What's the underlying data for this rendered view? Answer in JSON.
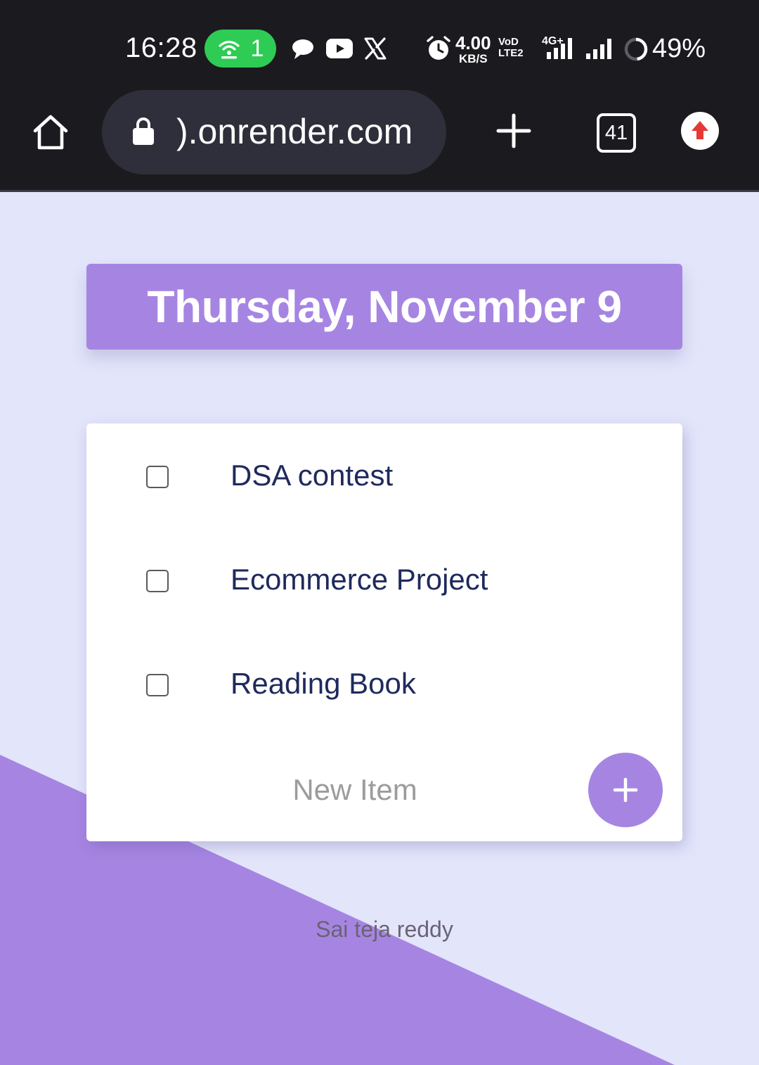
{
  "status_bar": {
    "time": "16:28",
    "hotspot_count": "1",
    "net_speed_value": "4.00",
    "net_speed_unit": "KB/S",
    "volte_line1": "VoD",
    "volte_line2": "LTE2",
    "network_type": "4G+",
    "battery": "49%",
    "notification_icons": [
      "chat-bubble-icon",
      "youtube-icon",
      "x-icon"
    ],
    "system_icons": [
      "alarm-icon",
      "signal-icon",
      "battery-icon"
    ]
  },
  "toolbar": {
    "url": ").onrender.com",
    "tabs_count": "41",
    "icons": [
      "home-icon",
      "lock-icon",
      "new-tab-icon",
      "tabs-icon",
      "update-icon"
    ]
  },
  "page": {
    "title": "Thursday, November 9",
    "items": [
      {
        "label": "DSA contest",
        "checked": false
      },
      {
        "label": "Ecommerce Project",
        "checked": false
      },
      {
        "label": "Reading Book",
        "checked": false
      }
    ],
    "new_item_placeholder": "New Item",
    "add_button_label": "+",
    "footer": "Sai teja reddy"
  },
  "colors": {
    "accent": "#a685e2",
    "page_background": "#e3e5fb",
    "status_bar": "#1b1b1f",
    "hotspot_green": "#2ecc54",
    "item_text": "#1f2a5c",
    "update_red": "#e53935"
  }
}
